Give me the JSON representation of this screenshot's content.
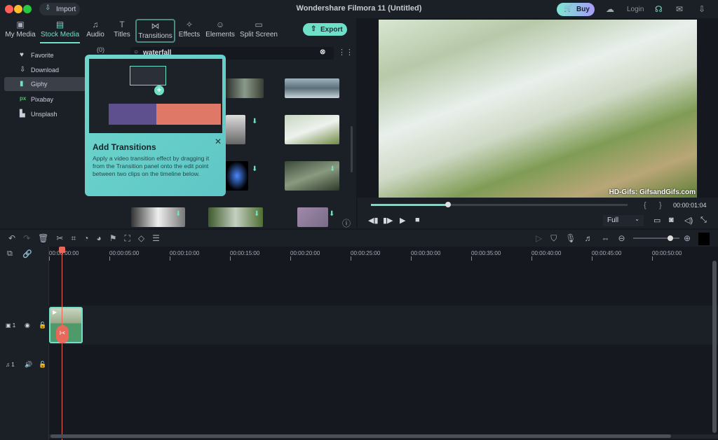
{
  "titlebar": {
    "import_label": "Import",
    "title": "Wondershare Filmora 11 (Untitled)",
    "buy_label": "Buy",
    "login_label": "Login"
  },
  "tabs": [
    {
      "label": "My Media",
      "icon": "image-icon"
    },
    {
      "label": "Stock Media",
      "icon": "stock-icon",
      "active": true
    },
    {
      "label": "Audio",
      "icon": "music-icon"
    },
    {
      "label": "Titles",
      "icon": "text-icon"
    },
    {
      "label": "Transitions",
      "icon": "transition-icon",
      "highlighted": true
    },
    {
      "label": "Effects",
      "icon": "sparkle-icon"
    },
    {
      "label": "Elements",
      "icon": "smiley-icon"
    },
    {
      "label": "Split Screen",
      "icon": "split-icon"
    }
  ],
  "export_label": "Export",
  "sidebar": {
    "items": [
      {
        "label": "Favorite",
        "count": "(0)"
      },
      {
        "label": "Download"
      },
      {
        "label": "Giphy",
        "selected": true
      },
      {
        "label": "Pixabay"
      },
      {
        "label": "Unsplash"
      }
    ]
  },
  "search": {
    "value": "waterfall"
  },
  "coach": {
    "title": "Add Transitions",
    "body": "Apply a video transition effect by dragging it from the Transition panel onto the edit point between two clips on the timeline below."
  },
  "preview": {
    "watermark": "HD-Gifs: GifsandGifs.com",
    "timecode": "00:00:01:04",
    "progress": 0.3,
    "quality": "Full"
  },
  "timeline": {
    "ruler": [
      "00:00:00:00",
      "00:00:05:00",
      "00:00:10:00",
      "00:00:15:00",
      "00:00:20:00",
      "00:00:25:00",
      "00:00:30:00",
      "00:00:35:00",
      "00:00:40:00",
      "00:00:45:00",
      "00:00:50:00"
    ],
    "video_track": "1",
    "audio_track": "1",
    "zoom": 0.8
  },
  "colors": {
    "accent": "#6fe0c8",
    "playhead": "#e8685a"
  }
}
